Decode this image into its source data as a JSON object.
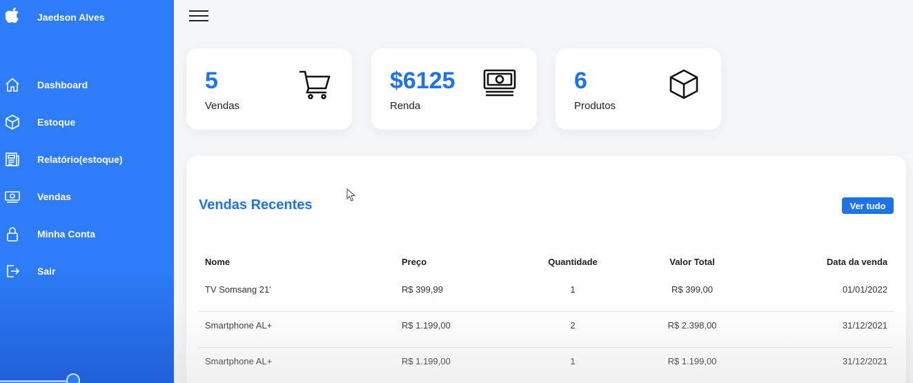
{
  "sidebar": {
    "logo_icon": "apple-logo-icon",
    "user_name": "Jaedson Alves",
    "items": [
      {
        "label": "Dashboard",
        "icon": "home-icon"
      },
      {
        "label": "Estoque",
        "icon": "box-icon"
      },
      {
        "label": "Relatório(estoque)",
        "icon": "newspaper-icon"
      },
      {
        "label": "Vendas",
        "icon": "money-icon"
      },
      {
        "label": "Minha Conta",
        "icon": "lock-icon"
      },
      {
        "label": "Sair",
        "icon": "logout-icon"
      }
    ],
    "color": "#2d7cf8"
  },
  "topbar": {
    "menu_icon": "hamburger-menu-icon"
  },
  "cards": [
    {
      "value": "5",
      "label": "Vendas",
      "icon": "cart-icon"
    },
    {
      "value": "$6125",
      "label": "Renda",
      "icon": "cash-icon"
    },
    {
      "value": "6",
      "label": "Produtos",
      "icon": "cube-icon"
    }
  ],
  "recent_sales": {
    "title": "Vendas Recentes",
    "see_all_label": "Ver tudo",
    "columns": [
      "Nome",
      "Preço",
      "Quantidade",
      "Valor Total",
      "Data da venda"
    ],
    "rows": [
      [
        "TV Somsang 21'",
        "R$ 399,99",
        "1",
        "R$ 399,00",
        "01/01/2022"
      ],
      [
        "Smartphone AL+",
        "R$ 1.199,00",
        "2",
        "R$ 2.398,00",
        "31/12/2021"
      ],
      [
        "Smartphone AL+",
        "R$ 1.199,00",
        "1",
        "R$ 1.199,00",
        "31/12/2021"
      ]
    ]
  },
  "accent_color": "#1e73e6"
}
